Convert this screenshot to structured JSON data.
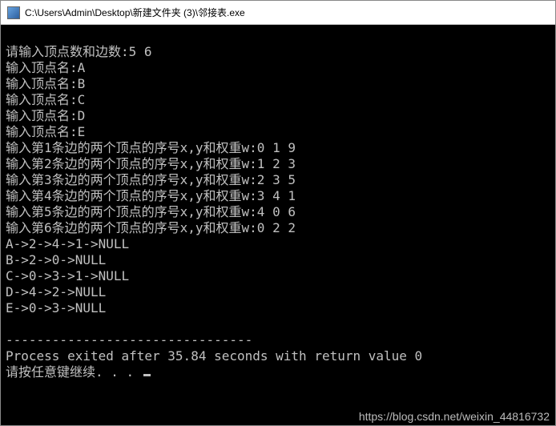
{
  "window": {
    "title": "C:\\Users\\Admin\\Desktop\\新建文件夹 (3)\\邻接表.exe"
  },
  "console": {
    "lines": [
      "请输入顶点数和边数:5 6",
      "输入顶点名:A",
      "输入顶点名:B",
      "输入顶点名:C",
      "输入顶点名:D",
      "输入顶点名:E",
      "输入第1条边的两个顶点的序号x,y和权重w:0 1 9",
      "输入第2条边的两个顶点的序号x,y和权重w:1 2 3",
      "输入第3条边的两个顶点的序号x,y和权重w:2 3 5",
      "输入第4条边的两个顶点的序号x,y和权重w:3 4 1",
      "输入第5条边的两个顶点的序号x,y和权重w:4 0 6",
      "输入第6条边的两个顶点的序号x,y和权重w:0 2 2",
      "A->2->4->1->NULL",
      "B->2->0->NULL",
      "C->0->3->1->NULL",
      "D->4->2->NULL",
      "E->0->3->NULL",
      "",
      "--------------------------------",
      "Process exited after 35.84 seconds with return value 0",
      "请按任意键继续. . . "
    ]
  },
  "watermark": "https://blog.csdn.net/weixin_44816732"
}
